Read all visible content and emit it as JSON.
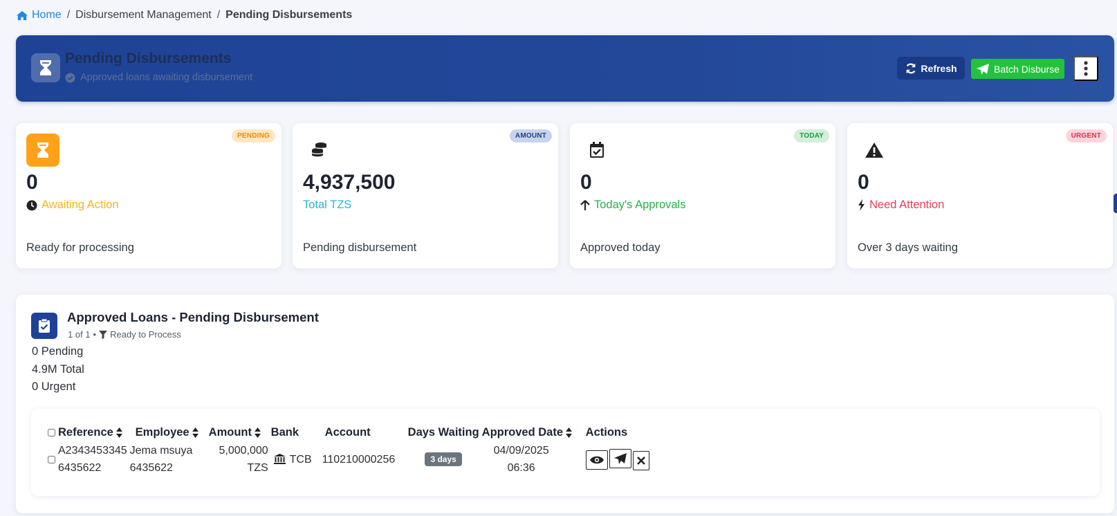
{
  "breadcrumb": {
    "home": "Home",
    "section": "Disbursement Management",
    "current": "Pending Disbursements"
  },
  "header": {
    "title": "Pending Disbursements",
    "subtitle": "Approved loans awaiting disbursement",
    "refresh_label": "Refresh",
    "batch_label": "Batch Disburse"
  },
  "cards": [
    {
      "badge": "PENDING",
      "value": "0",
      "label": "Awaiting Action",
      "desc": "Ready for processing"
    },
    {
      "badge": "AMOUNT",
      "value": "4,937,500",
      "label": "Total TZS",
      "desc": "Pending disbursement"
    },
    {
      "badge": "TODAY",
      "value": "0",
      "label": "Today's Approvals",
      "desc": "Approved today"
    },
    {
      "badge": "URGENT",
      "value": "0",
      "label": "Need Attention",
      "desc": "Over 3 days waiting"
    }
  ],
  "panel": {
    "title": "Approved Loans - Pending Disbursement",
    "page_info": "1 of 1",
    "filter": "Ready to Process",
    "summary": [
      "0 Pending",
      "4.9M Total",
      "0 Urgent"
    ]
  },
  "table": {
    "headers": [
      "Reference",
      "Employee",
      "Amount",
      "Bank",
      "Account",
      "Days Waiting",
      "Approved Date",
      "Actions"
    ],
    "rows": [
      {
        "reference_1": "A2343453345",
        "reference_2": "6435622",
        "employee_1": "Jema msuya",
        "employee_2": "6435622",
        "amount_1": "5,000,000",
        "amount_2": "TZS",
        "bank": "TCB",
        "account": "110210000256",
        "days": "3 days",
        "date_1": "04/09/2025",
        "date_2": "06:36"
      }
    ]
  },
  "colors": {
    "primary": "#1e4396",
    "success": "#22c33b",
    "pending": "#ffa21a",
    "amount": "#29b6d6",
    "today": "#22b34a",
    "urgent": "#e8405a"
  }
}
